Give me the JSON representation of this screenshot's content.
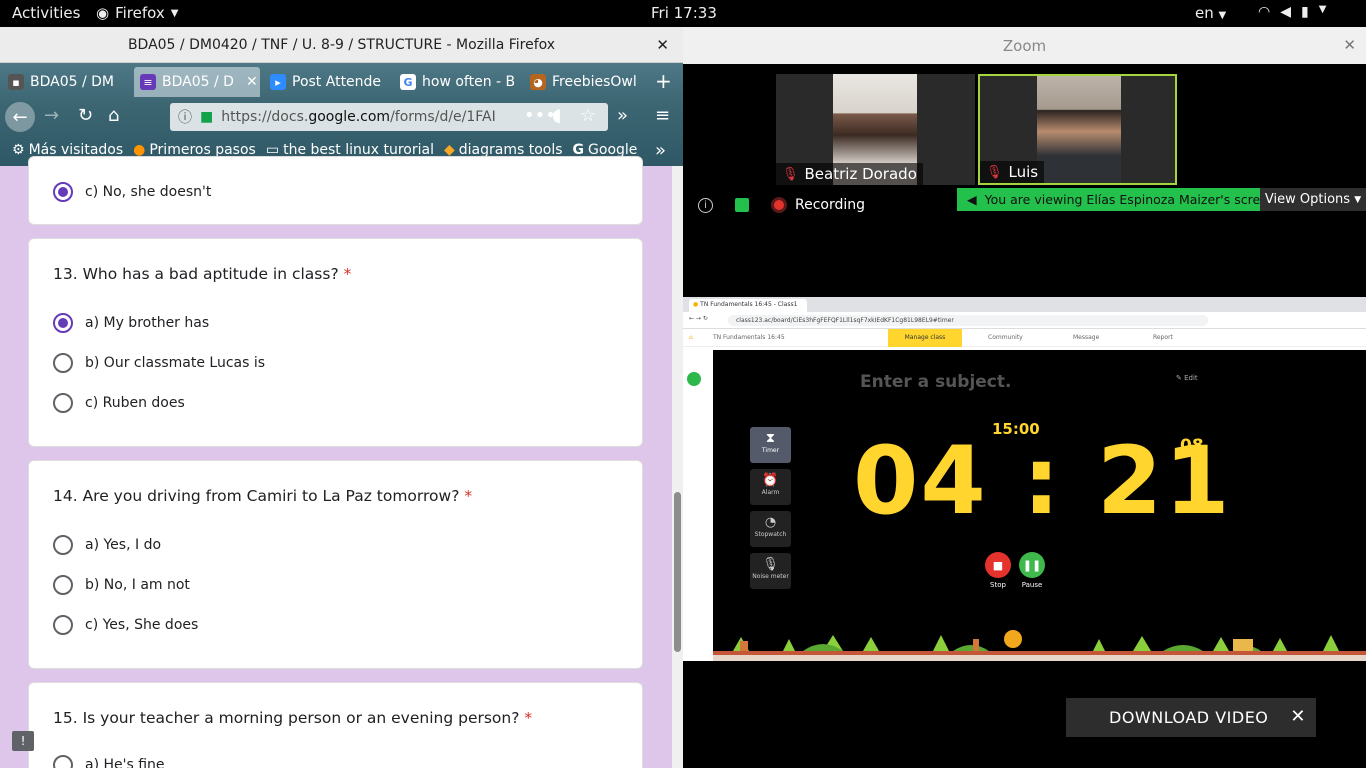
{
  "topbar": {
    "activities": "Activities",
    "app": "Firefox",
    "clock": "Fri 17:33",
    "lang": "en"
  },
  "firefox": {
    "window_title": "BDA05 / DM0420 / TNF / U. 8-9 / STRUCTURE - Mozilla Firefox",
    "tabs": [
      "BDA05 / DM",
      "BDA05 / D",
      "Post Attende",
      "how often - B",
      "FreebiesOwl"
    ],
    "url": "https://docs.google.com/forms/d/e/1FAI",
    "url_pre": "https://docs.",
    "url_host": "google.com",
    "url_post": "/forms/d/e/1FAI",
    "bookmarks": [
      "Más visitados",
      "Primeros pasos",
      "the best linux turorial",
      "diagrams tools",
      "Google"
    ]
  },
  "form": {
    "prev_option": "c) No, she doesn't",
    "q13": {
      "title": "13. Who has a bad aptitude in class?",
      "required": "*",
      "options": [
        "a) My brother has",
        "b) Our classmate Lucas is",
        "c) Ruben does"
      ],
      "selected": 0
    },
    "q14": {
      "title": "14. Are you driving from Camiri to La Paz tomorrow?",
      "required": "*",
      "options": [
        "a) Yes, I do",
        "b) No, I am not",
        "c) Yes, She does"
      ]
    },
    "q15": {
      "title": "15. Is your teacher a morning person or an evening person?",
      "required": "*",
      "options": [
        "a) He's fine"
      ]
    }
  },
  "zoom": {
    "window_title": "Zoom",
    "participants": [
      "Beatriz Dorado",
      "Luis"
    ],
    "recording": "Recording",
    "viewing": "You are viewing Elías Espinoza Maizer's screen",
    "view_options": "View Options",
    "download": "DOWNLOAD VIDEO"
  },
  "shared_screen": {
    "tab_title": "TN Fundamentals 16:45 - Class1",
    "url": "class123.ac/board/CiEs3hFgFEFQF1Lll1sqF7xkIEdKF1Cg81L98EL9#timer",
    "header_title": "TN Fundamentals 16:45",
    "nav": [
      "Manage class",
      "Community",
      "Message",
      "Report"
    ],
    "subject": "Enter a subject.",
    "edit": "Edit",
    "tools": [
      "Timer",
      "Alarm",
      "Stopwatch",
      "Noise meter"
    ],
    "total_time": "15:00",
    "time_display": "04 : 21",
    "seconds": "08",
    "stop": "Stop",
    "pause": "Pause"
  },
  "colors": {
    "form_accent": "#673ab7",
    "form_bg": "#ddc6ea",
    "timer_yellow": "#ffd52e",
    "zoom_green": "#23c04b",
    "record_red": "#e5322d"
  }
}
